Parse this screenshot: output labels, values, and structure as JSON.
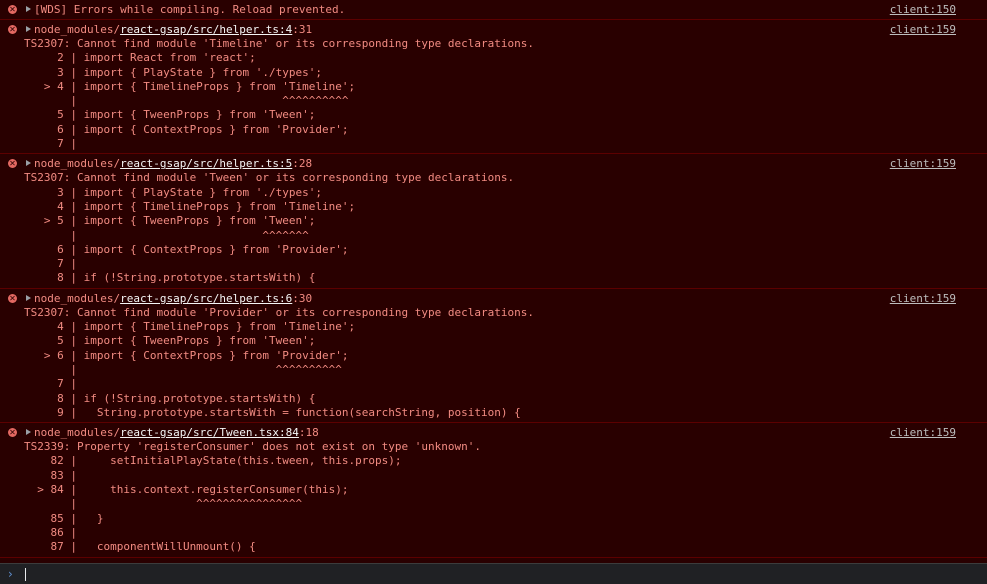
{
  "messages": [
    {
      "path_pre": "",
      "path_link": "",
      "path_post": "",
      "head_text": "[WDS] Errors while compiling. Reload prevented.",
      "source": "client:150",
      "body": []
    },
    {
      "path_pre": "node_modules/",
      "path_link": "react-gsap/src/helper.ts:4",
      "path_post": ":31",
      "source": "client:159",
      "body": [
        "TS2307: Cannot find module 'Timeline' or its corresponding type declarations.",
        "     2 | import React from 'react';",
        "     3 | import { PlayState } from './types';",
        "   > 4 | import { TimelineProps } from 'Timeline';",
        "       |                               ^^^^^^^^^^",
        "     5 | import { TweenProps } from 'Tween';",
        "     6 | import { ContextProps } from 'Provider';",
        "     7 |"
      ]
    },
    {
      "path_pre": "node_modules/",
      "path_link": "react-gsap/src/helper.ts:5",
      "path_post": ":28",
      "source": "client:159",
      "body": [
        "TS2307: Cannot find module 'Tween' or its corresponding type declarations.",
        "     3 | import { PlayState } from './types';",
        "     4 | import { TimelineProps } from 'Timeline';",
        "   > 5 | import { TweenProps } from 'Tween';",
        "       |                            ^^^^^^^",
        "     6 | import { ContextProps } from 'Provider';",
        "     7 |",
        "     8 | if (!String.prototype.startsWith) {"
      ]
    },
    {
      "path_pre": "node_modules/",
      "path_link": "react-gsap/src/helper.ts:6",
      "path_post": ":30",
      "source": "client:159",
      "body": [
        "TS2307: Cannot find module 'Provider' or its corresponding type declarations.",
        "     4 | import { TimelineProps } from 'Timeline';",
        "     5 | import { TweenProps } from 'Tween';",
        "   > 6 | import { ContextProps } from 'Provider';",
        "       |                              ^^^^^^^^^^",
        "     7 |",
        "     8 | if (!String.prototype.startsWith) {",
        "     9 |   String.prototype.startsWith = function(searchString, position) {"
      ]
    },
    {
      "path_pre": "node_modules/",
      "path_link": "react-gsap/src/Tween.tsx:84",
      "path_post": ":18",
      "source": "client:159",
      "body": [
        "TS2339: Property 'registerConsumer' does not exist on type 'unknown'.",
        "    82 |     setInitialPlayState(this.tween, this.props);",
        "    83 |",
        "  > 84 |     this.context.registerConsumer(this);",
        "       |                  ^^^^^^^^^^^^^^^^",
        "    85 |   }",
        "    86 |",
        "    87 |   componentWillUnmount() {"
      ]
    }
  ],
  "icons": {
    "error": "error-circle-icon",
    "expand": "expand-triangle-icon",
    "prompt": "prompt-chevron-icon"
  },
  "colors": {
    "background": "#290000",
    "error_text": "#f28b82",
    "border": "#5c0000",
    "link": "#bdbdbd"
  }
}
